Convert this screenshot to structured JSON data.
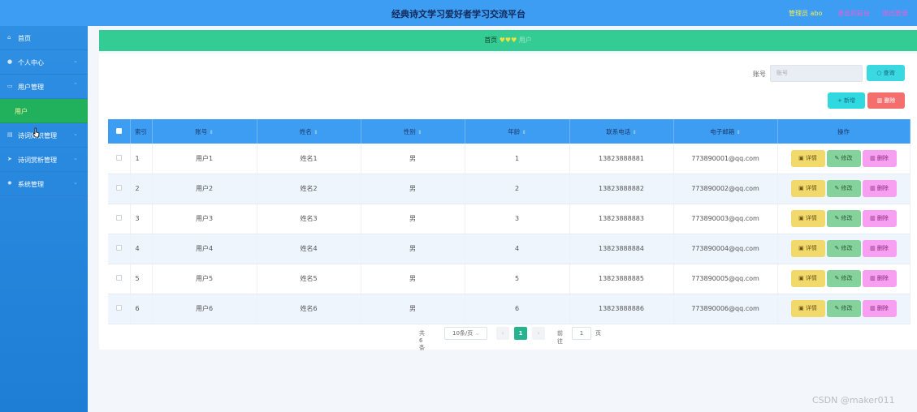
{
  "header": {
    "title": "经典诗文学习爱好者学习交流平台",
    "user": "管理员 abo",
    "link_front": "退出到前台",
    "link_logout": "退出登录"
  },
  "sidebar": {
    "items": [
      {
        "label": "首页",
        "icon": "home-icon"
      },
      {
        "label": "个人中心",
        "icon": "person-icon"
      },
      {
        "label": "用户管理",
        "icon": "user-group-icon"
      },
      {
        "label": "用户",
        "sub": true
      },
      {
        "label": "诗词知识管理",
        "icon": "book-icon"
      },
      {
        "label": "诗词赏析管理",
        "icon": "send-icon"
      },
      {
        "label": "系统管理",
        "icon": "gear-icon"
      }
    ]
  },
  "breadcrumb": {
    "home": "首页",
    "hearts": "♥♥♥",
    "current": "用户"
  },
  "search": {
    "label": "账号",
    "placeholder": "账号",
    "query_button": "查询"
  },
  "actions": {
    "add": "新增",
    "delete": "删除"
  },
  "table": {
    "headers": [
      "索引",
      "账号",
      "姓名",
      "性别",
      "年龄",
      "联系电话",
      "电子邮箱",
      "操作"
    ],
    "rows": [
      {
        "index": "1",
        "account": "用户1",
        "name": "姓名1",
        "gender": "男",
        "age": "1",
        "phone": "13823888881",
        "email": "773890001@qq.com"
      },
      {
        "index": "2",
        "account": "用户2",
        "name": "姓名2",
        "gender": "男",
        "age": "2",
        "phone": "13823888882",
        "email": "773890002@qq.com"
      },
      {
        "index": "3",
        "account": "用户3",
        "name": "姓名3",
        "gender": "男",
        "age": "3",
        "phone": "13823888883",
        "email": "773890003@qq.com"
      },
      {
        "index": "4",
        "account": "用户4",
        "name": "姓名4",
        "gender": "男",
        "age": "4",
        "phone": "13823888884",
        "email": "773890004@qq.com"
      },
      {
        "index": "5",
        "account": "用户5",
        "name": "姓名5",
        "gender": "男",
        "age": "5",
        "phone": "13823888885",
        "email": "773890005@qq.com"
      },
      {
        "index": "6",
        "account": "用户6",
        "name": "姓名6",
        "gender": "男",
        "age": "6",
        "phone": "13823888886",
        "email": "773890006@qq.com"
      }
    ],
    "row_actions": {
      "detail": "详情",
      "edit": "修改",
      "delete": "删除"
    }
  },
  "pagination": {
    "total": "共 6 条",
    "page_size": "10条/页",
    "current": "1",
    "goto_prefix": "前往",
    "goto_value": "1",
    "goto_suffix": "页"
  },
  "watermark": "CSDN @maker011",
  "colors": {
    "header": "#3d9df2",
    "sidebar": "#1e7ed6",
    "active": "#21b15c",
    "breadcrumb": "#33cc94"
  }
}
